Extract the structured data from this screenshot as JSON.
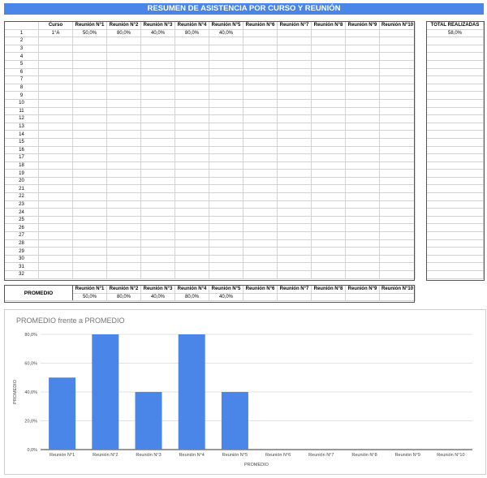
{
  "title": "RESUMEN DE ASISTENCIA POR CURSO Y REUNIÓN",
  "summary_table": {
    "headers": [
      "Curso",
      "Reunión N°1",
      "Reunión N°2",
      "Reunión N°3",
      "Reunión N°4",
      "Reunión N°5",
      "Reunión N°6",
      "Reunión N°7",
      "Reunión N°8",
      "Reunión N°9",
      "Reunión N°10"
    ],
    "rows": [
      {
        "n": "1",
        "curso": "1°A",
        "values": [
          "50,0%",
          "80,0%",
          "40,0%",
          "80,0%",
          "40,0%",
          "",
          "",
          "",
          "",
          ""
        ]
      },
      {
        "n": "2",
        "curso": "",
        "values": [
          "",
          "",
          "",
          "",
          "",
          "",
          "",
          "",
          "",
          ""
        ]
      },
      {
        "n": "3",
        "curso": "",
        "values": [
          "",
          "",
          "",
          "",
          "",
          "",
          "",
          "",
          "",
          ""
        ]
      },
      {
        "n": "4",
        "curso": "",
        "values": [
          "",
          "",
          "",
          "",
          "",
          "",
          "",
          "",
          "",
          ""
        ]
      },
      {
        "n": "5",
        "curso": "",
        "values": [
          "",
          "",
          "",
          "",
          "",
          "",
          "",
          "",
          "",
          ""
        ]
      },
      {
        "n": "6",
        "curso": "",
        "values": [
          "",
          "",
          "",
          "",
          "",
          "",
          "",
          "",
          "",
          ""
        ]
      },
      {
        "n": "7",
        "curso": "",
        "values": [
          "",
          "",
          "",
          "",
          "",
          "",
          "",
          "",
          "",
          ""
        ]
      },
      {
        "n": "8",
        "curso": "",
        "values": [
          "",
          "",
          "",
          "",
          "",
          "",
          "",
          "",
          "",
          ""
        ]
      },
      {
        "n": "9",
        "curso": "",
        "values": [
          "",
          "",
          "",
          "",
          "",
          "",
          "",
          "",
          "",
          ""
        ]
      },
      {
        "n": "10",
        "curso": "",
        "values": [
          "",
          "",
          "",
          "",
          "",
          "",
          "",
          "",
          "",
          ""
        ]
      },
      {
        "n": "11",
        "curso": "",
        "values": [
          "",
          "",
          "",
          "",
          "",
          "",
          "",
          "",
          "",
          ""
        ]
      },
      {
        "n": "12",
        "curso": "",
        "values": [
          "",
          "",
          "",
          "",
          "",
          "",
          "",
          "",
          "",
          ""
        ]
      },
      {
        "n": "13",
        "curso": "",
        "values": [
          "",
          "",
          "",
          "",
          "",
          "",
          "",
          "",
          "",
          ""
        ]
      },
      {
        "n": "14",
        "curso": "",
        "values": [
          "",
          "",
          "",
          "",
          "",
          "",
          "",
          "",
          "",
          ""
        ]
      },
      {
        "n": "15",
        "curso": "",
        "values": [
          "",
          "",
          "",
          "",
          "",
          "",
          "",
          "",
          "",
          ""
        ]
      },
      {
        "n": "16",
        "curso": "",
        "values": [
          "",
          "",
          "",
          "",
          "",
          "",
          "",
          "",
          "",
          ""
        ]
      },
      {
        "n": "17",
        "curso": "",
        "values": [
          "",
          "",
          "",
          "",
          "",
          "",
          "",
          "",
          "",
          ""
        ]
      },
      {
        "n": "18",
        "curso": "",
        "values": [
          "",
          "",
          "",
          "",
          "",
          "",
          "",
          "",
          "",
          ""
        ]
      },
      {
        "n": "19",
        "curso": "",
        "values": [
          "",
          "",
          "",
          "",
          "",
          "",
          "",
          "",
          "",
          ""
        ]
      },
      {
        "n": "20",
        "curso": "",
        "values": [
          "",
          "",
          "",
          "",
          "",
          "",
          "",
          "",
          "",
          ""
        ]
      },
      {
        "n": "21",
        "curso": "",
        "values": [
          "",
          "",
          "",
          "",
          "",
          "",
          "",
          "",
          "",
          ""
        ]
      },
      {
        "n": "22",
        "curso": "",
        "values": [
          "",
          "",
          "",
          "",
          "",
          "",
          "",
          "",
          "",
          ""
        ]
      },
      {
        "n": "23",
        "curso": "",
        "values": [
          "",
          "",
          "",
          "",
          "",
          "",
          "",
          "",
          "",
          ""
        ]
      },
      {
        "n": "24",
        "curso": "",
        "values": [
          "",
          "",
          "",
          "",
          "",
          "",
          "",
          "",
          "",
          ""
        ]
      },
      {
        "n": "25",
        "curso": "",
        "values": [
          "",
          "",
          "",
          "",
          "",
          "",
          "",
          "",
          "",
          ""
        ]
      },
      {
        "n": "26",
        "curso": "",
        "values": [
          "",
          "",
          "",
          "",
          "",
          "",
          "",
          "",
          "",
          ""
        ]
      },
      {
        "n": "27",
        "curso": "",
        "values": [
          "",
          "",
          "",
          "",
          "",
          "",
          "",
          "",
          "",
          ""
        ]
      },
      {
        "n": "28",
        "curso": "",
        "values": [
          "",
          "",
          "",
          "",
          "",
          "",
          "",
          "",
          "",
          ""
        ]
      },
      {
        "n": "29",
        "curso": "",
        "values": [
          "",
          "",
          "",
          "",
          "",
          "",
          "",
          "",
          "",
          ""
        ]
      },
      {
        "n": "30",
        "curso": "",
        "values": [
          "",
          "",
          "",
          "",
          "",
          "",
          "",
          "",
          "",
          ""
        ]
      },
      {
        "n": "31",
        "curso": "",
        "values": [
          "",
          "",
          "",
          "",
          "",
          "",
          "",
          "",
          "",
          ""
        ]
      },
      {
        "n": "32",
        "curso": "",
        "values": [
          "",
          "",
          "",
          "",
          "",
          "",
          "",
          "",
          "",
          ""
        ]
      }
    ]
  },
  "totals": {
    "header": "TOTAL REALIZADAS",
    "values": [
      "58,0%"
    ]
  },
  "promedio": {
    "label": "PROMEDIO",
    "headers": [
      "Reunión N°1",
      "Reunión N°2",
      "Reunión N°3",
      "Reunión N°4",
      "Reunión N°5",
      "Reunión N°6",
      "Reunión N°7",
      "Reunión N°8",
      "Reunión N°9",
      "Reunión N°10"
    ],
    "values": [
      "50,0%",
      "80,0%",
      "40,0%",
      "80,0%",
      "40,0%",
      "",
      "",
      "",
      "",
      ""
    ]
  },
  "chart_data": {
    "type": "bar",
    "title": "PROMEDIO frente a PROMEDIO",
    "xlabel": "PROMEDIO",
    "ylabel": "PROMEDIO",
    "categories": [
      "Reunión N°1",
      "Reunión N°2",
      "Reunión N°3",
      "Reunión N°4",
      "Reunión N°5",
      "Reunión N°6",
      "Reunión N°7",
      "Reunión N°8",
      "Reunión N°9",
      "Reunión N°10"
    ],
    "values": [
      0.5,
      0.8,
      0.4,
      0.8,
      0.4,
      null,
      null,
      null,
      null,
      null
    ],
    "ylim": [
      0,
      0.8
    ],
    "yticks": [
      "0,0%",
      "20,0%",
      "40,0%",
      "60,0%",
      "80,0%"
    ],
    "grid": true,
    "legend": "none",
    "bar_color": "#4a86e8"
  },
  "colors": {
    "banner": "#4a86e8",
    "bar": "#4a86e8"
  }
}
